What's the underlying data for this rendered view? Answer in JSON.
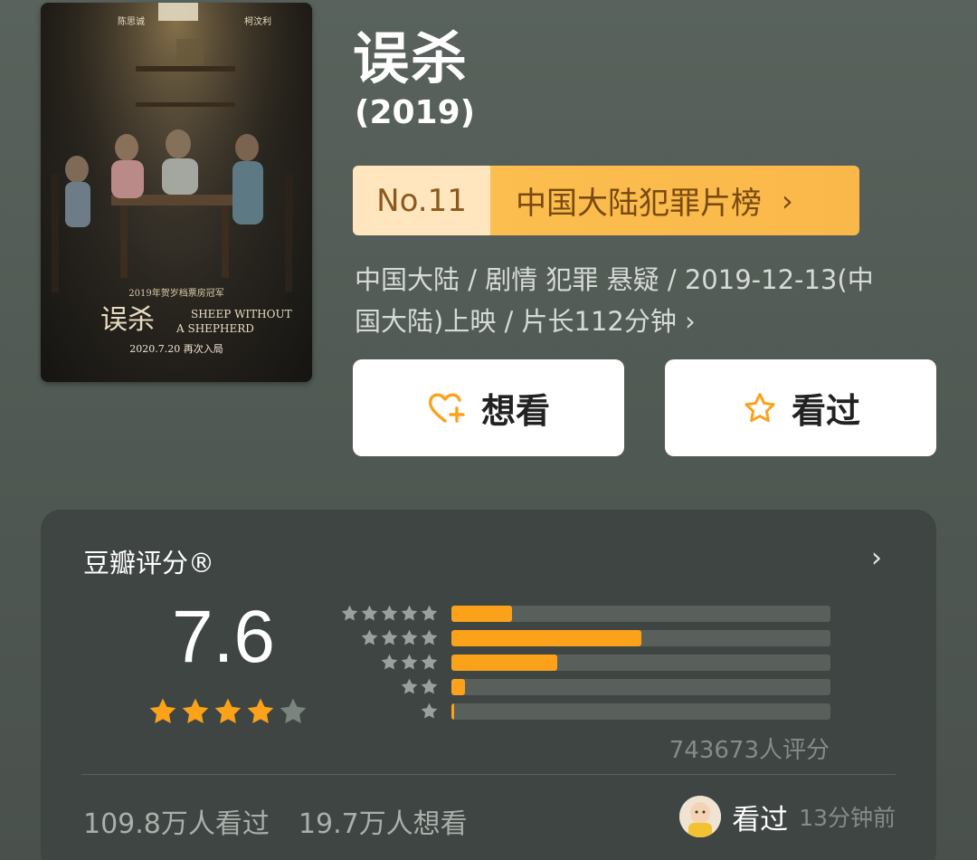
{
  "movie": {
    "title": "误杀",
    "year": "(2019)"
  },
  "poster": {
    "top_names": [
      "陈思诚",
      "柯汶利"
    ],
    "title_cn": "误杀",
    "title_en_1": "SHEEP WITHOUT",
    "title_en_2": "A SHEPHERD",
    "tagline": "2019年贺岁档票房冠军",
    "date_line": "2020.7.20  再次入局"
  },
  "ranking": {
    "number": "No.11",
    "list_name": "中国大陆犯罪片榜",
    "chevron": "›"
  },
  "info": {
    "line1": "中国大陆 / 剧情 犯罪 悬疑 / 2019-12-13(中",
    "line2": "国大陆)上映 / 片长112分钟 ",
    "chevron": "›"
  },
  "actions": {
    "want_label": "想看",
    "seen_label": "看过"
  },
  "rating": {
    "title": "豆瓣评分®",
    "chevron": "›",
    "score": "7.6",
    "stars_full": 4,
    "stars_total": 5,
    "distribution": [
      {
        "stars": 5,
        "fraction": 0.16
      },
      {
        "stars": 4,
        "fraction": 0.5
      },
      {
        "stars": 3,
        "fraction": 0.28
      },
      {
        "stars": 2,
        "fraction": 0.035
      },
      {
        "stars": 1,
        "fraction": 0.006
      }
    ],
    "count_text": "743673人评分",
    "seen_text": "109.8万人看过",
    "want_text": "19.7万人想看",
    "user_status": "看过",
    "user_time": "13分钟前"
  },
  "colors": {
    "accent_orange": "#fba21a",
    "rank_light": "#ffe6bf",
    "rank_gold": "#fbbe4f"
  }
}
